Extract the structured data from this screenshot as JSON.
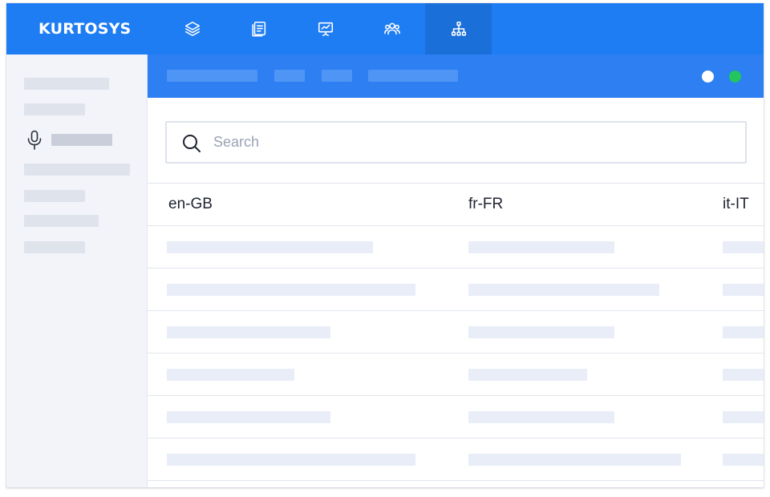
{
  "app": {
    "logo_text": "KURTOSYS"
  },
  "topnav": {
    "items": [
      {
        "icon": "layers-icon",
        "active": false
      },
      {
        "icon": "document-icon",
        "active": false
      },
      {
        "icon": "presentation-chart-icon",
        "active": false
      },
      {
        "icon": "users-icon",
        "active": false
      },
      {
        "icon": "hierarchy-icon",
        "active": true
      }
    ]
  },
  "sidebar": {
    "active_item_icon": "microphone-icon"
  },
  "status": {
    "dots": [
      {
        "color": "#ffffff"
      },
      {
        "color": "#22c55e"
      }
    ]
  },
  "search": {
    "placeholder": "Search",
    "value": ""
  },
  "table": {
    "columns": [
      "en-GB",
      "fr-FR",
      "it-IT"
    ]
  },
  "colors": {
    "brand": "#1f7df3",
    "brand_active": "#1b6fd8",
    "subbar": "#2d7ff2",
    "sidebar_bg": "#f2f4f9"
  }
}
